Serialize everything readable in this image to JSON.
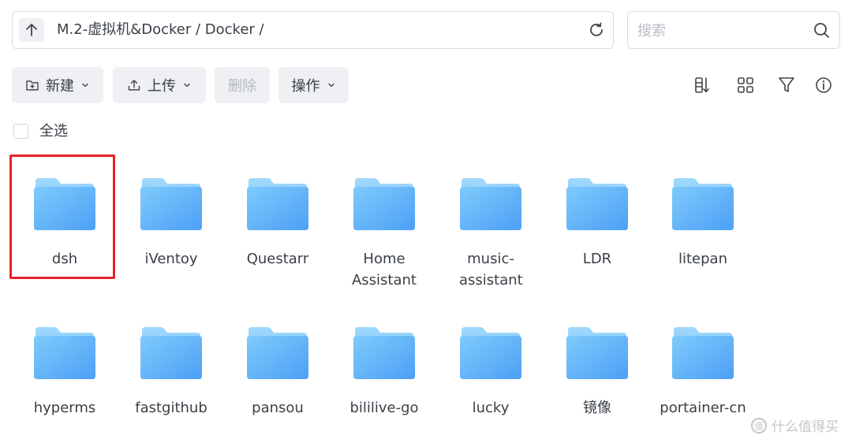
{
  "pathbar": {
    "path": "M.2-虚拟机&Docker / Docker /",
    "up_icon": "arrow-up-icon",
    "refresh_icon": "refresh-icon"
  },
  "search": {
    "placeholder": "搜索",
    "value": "",
    "icon": "search-icon"
  },
  "toolbar": {
    "new_label": "新建",
    "upload_label": "上传",
    "delete_label": "删除",
    "actions_label": "操作"
  },
  "right_icons": [
    "sort-icon",
    "grid-view-icon",
    "filter-icon",
    "info-icon"
  ],
  "select_all_label": "全选",
  "items": [
    {
      "name": "dsh"
    },
    {
      "name": "iVentoy"
    },
    {
      "name": "Questarr"
    },
    {
      "name": "Home Assistant"
    },
    {
      "name": "music-assistant"
    },
    {
      "name": "LDR"
    },
    {
      "name": "litepan"
    },
    {
      "name": "hyperms"
    },
    {
      "name": "fastgithub"
    },
    {
      "name": "pansou"
    },
    {
      "name": "bililive-go"
    },
    {
      "name": "lucky"
    },
    {
      "name": "镜像"
    },
    {
      "name": "portainer-cn"
    }
  ],
  "colors": {
    "folder_light": "#8ed0fb",
    "folder_dark": "#5aa9f7",
    "highlight": "#e8212b",
    "button_bg": "#eef0f3"
  },
  "watermark": {
    "text": "什么值得买",
    "logo": "值"
  }
}
